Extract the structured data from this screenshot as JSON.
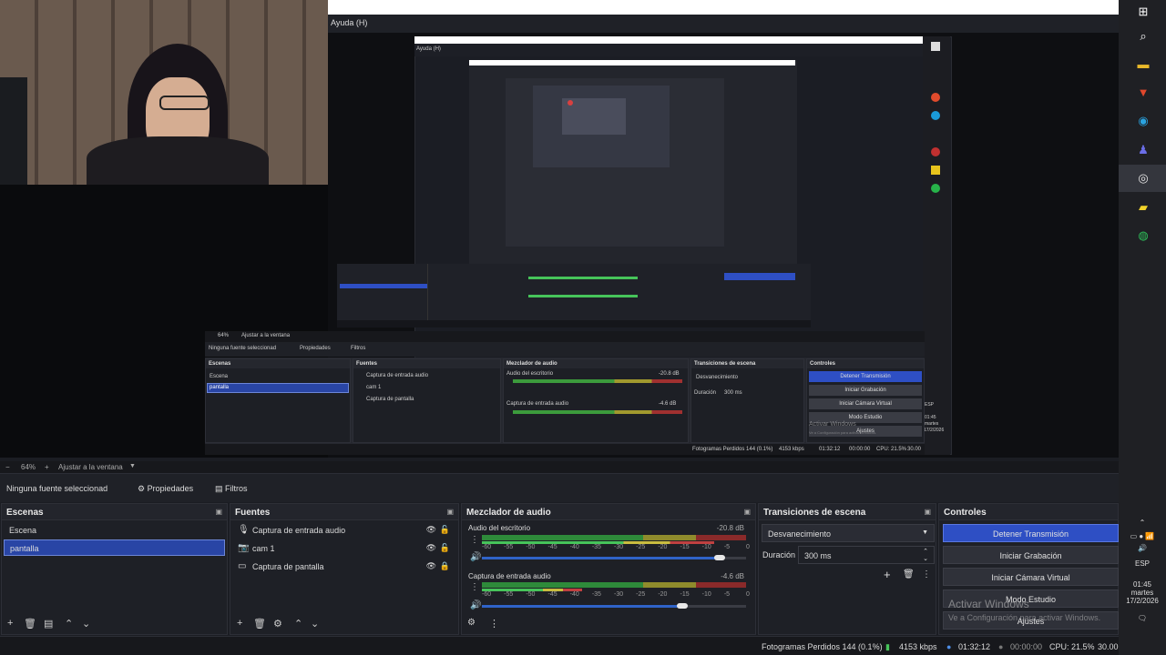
{
  "help_menu": "Ayuda (H)",
  "nested_help_menu": "Ayuda (H)",
  "toolbar": {
    "zoom": "64%",
    "fit_window": "Ajustar a la ventana"
  },
  "properties_bar": {
    "no_source": "Ninguna fuente seleccionad",
    "properties": "Propiedades",
    "filters": "Filtros"
  },
  "scenes": {
    "title": "Escenas",
    "items": [
      {
        "label": "Escena",
        "selected": false
      },
      {
        "label": "pantalla",
        "selected": true
      }
    ]
  },
  "sources": {
    "title": "Fuentes",
    "items": [
      {
        "label": "Captura de entrada audio",
        "icon": "microphone-icon"
      },
      {
        "label": "cam 1",
        "icon": "camera-icon"
      },
      {
        "label": "Captura de pantalla",
        "icon": "monitor-icon"
      }
    ]
  },
  "mixer": {
    "title": "Mezclador de audio",
    "channels": [
      {
        "name": "Audio del escritorio",
        "db": "-20.8 dB",
        "level": 0.88,
        "volume": 0.9
      },
      {
        "name": "Captura de entrada audio",
        "db": "-4.6 dB",
        "level": 0.38,
        "volume": 0.76
      }
    ],
    "scale": [
      "-60",
      "-55",
      "-50",
      "-45",
      "-40",
      "-35",
      "-30",
      "-25",
      "-20",
      "-15",
      "-10",
      "-5",
      "0"
    ]
  },
  "transitions": {
    "title": "Transiciones de escena",
    "selected": "Desvanecimiento",
    "duration_label": "Duración",
    "duration_value": "300 ms"
  },
  "controls": {
    "title": "Controles",
    "buttons": [
      {
        "label": "Detener Transmisión",
        "active": true
      },
      {
        "label": "Iniciar Grabación",
        "active": false
      },
      {
        "label": "Iniciar Cámara Virtual",
        "active": false
      },
      {
        "label": "Modo Estudio",
        "active": false
      },
      {
        "label": "Ajustes",
        "active": false
      }
    ]
  },
  "watermark": {
    "line1": "Activar Windows",
    "line2": "Ve a Configuración para activar Windows."
  },
  "statusbar": {
    "dropped_frames": "Fotogramas Perdidos 144 (0.1%)",
    "bitrate": "4153 kbps",
    "stream_time": "01:32:12",
    "rec_time": "00:00:00",
    "cpu": "CPU: 21.5%",
    "fps": "30.00"
  },
  "tray": {
    "lang": "ESP",
    "time": "01:45",
    "day": "martes",
    "date": "17/2/2026"
  },
  "nested": {
    "scenes": "Escenas",
    "sources": "Fuentes",
    "mixer": "Mezclador de audio",
    "transitions": "Transiciones de escena",
    "controls": "Controles",
    "no_source": "Ninguna fuente seleccionad",
    "properties": "Propiedades",
    "filters": "Filtros",
    "scene1": "Escena",
    "scene2": "pantalla",
    "src1": "Captura de entrada audio",
    "src2": "cam 1",
    "src3": "Captura de pantalla",
    "ch1": "Audio del escritorio",
    "ch1_db": "-20.8 dB",
    "ch2": "Captura de entrada audio",
    "ch2_db": "-4.6 dB",
    "fade": "Desvanecimiento",
    "duration": "Duración",
    "duration_val": "300 ms",
    "btn1": "Detener Transmisión",
    "btn2": "Iniciar Grabación",
    "btn3": "Iniciar Cámara Virtual",
    "btn4": "Modo Estudio",
    "btn5": "Ajustes",
    "zoom": "64%",
    "fit": "Ajustar a la ventana",
    "status": "Fotogramas Perdidos 144 (0.1%)",
    "bitrate": "4153 kbps",
    "time": "01:32:12",
    "rec": "00:00:00",
    "cpu": "CPU: 21.5%",
    "fps": "30.00",
    "watermark1": "Activar Windows",
    "watermark2": "Ve a Configuración para activar Windows.",
    "tray_lang": "ESP",
    "tray_time": "01:45",
    "tray_day": "martes",
    "tray_date": "17/2/2026"
  },
  "taskbar_icons": [
    "windows-icon",
    "search-icon",
    "file-explorer-icon",
    "brave-icon",
    "edge-icon",
    "teams-icon",
    "obs-icon",
    "sticky-notes-icon",
    "whatsapp-icon"
  ],
  "colors": {
    "accent": "#2e4fc4",
    "selection": "#2945a5",
    "background": "#1b1d23"
  }
}
